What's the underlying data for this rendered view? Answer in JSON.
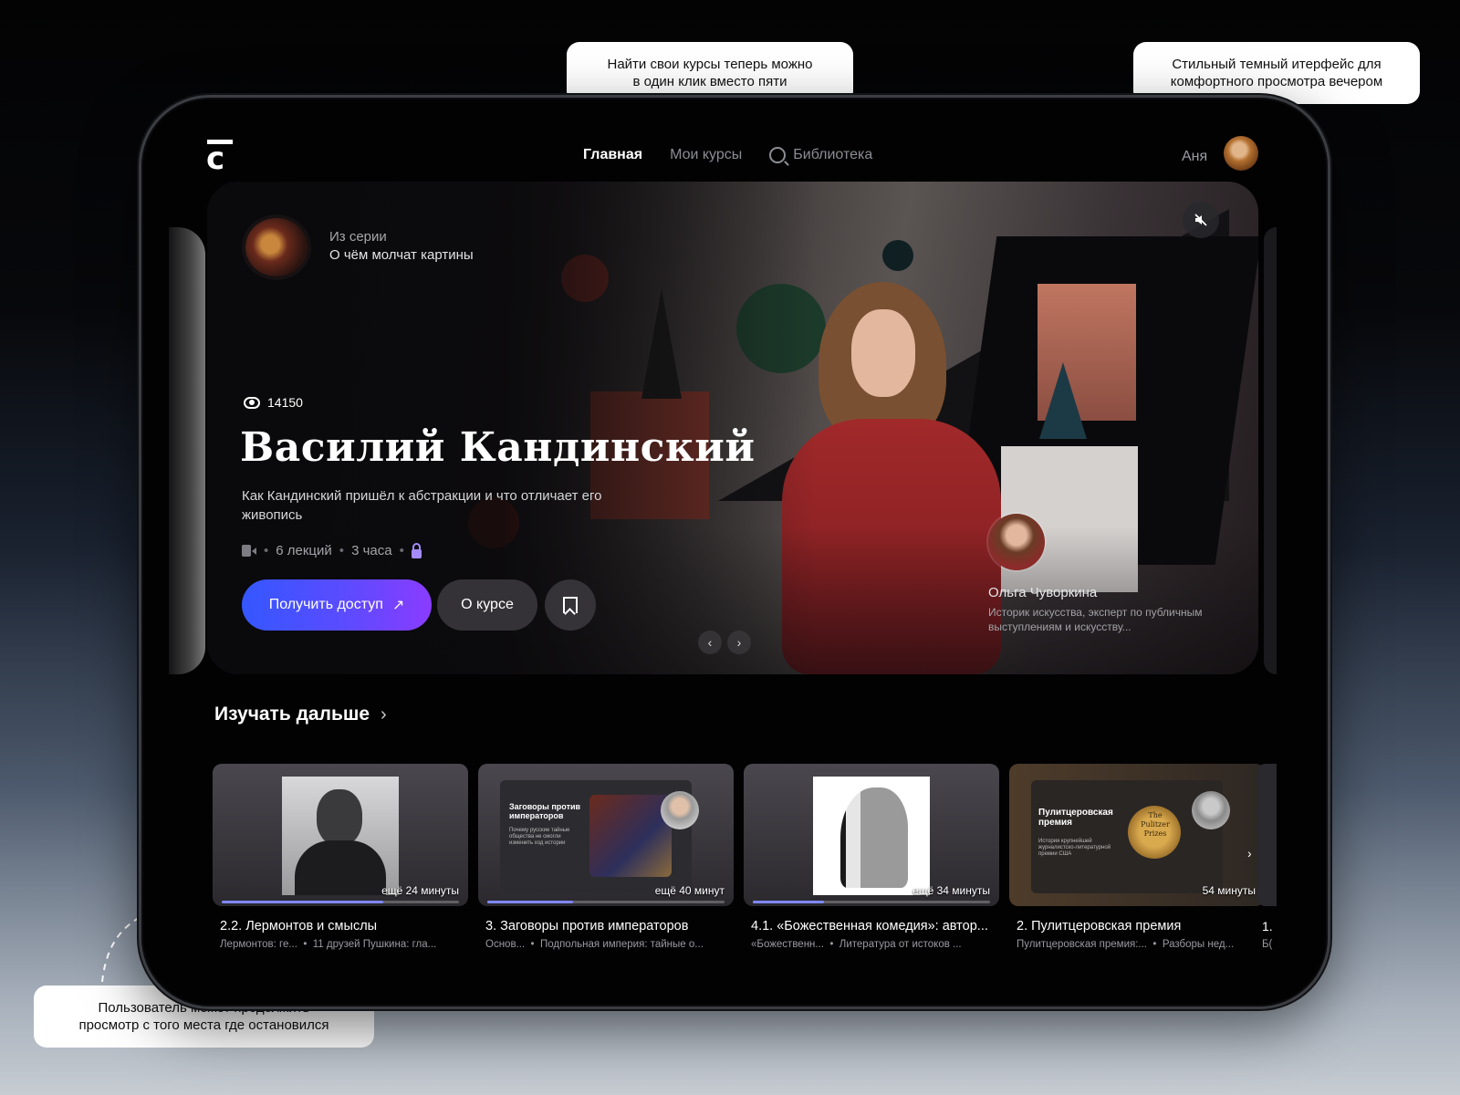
{
  "callouts": {
    "top": [
      "Найти свои курсы теперь можно",
      "в один клик вместо пяти"
    ],
    "right": [
      "Стильный темный итерфейс для",
      "комфортного просмотра вечером"
    ],
    "bottom": [
      "Пользователь может продолжить",
      "просмотр с того места где остановился"
    ]
  },
  "header": {
    "logo": "c",
    "nav": {
      "home": "Главная",
      "my_courses": "Мои курсы",
      "library": "Библиотека"
    },
    "user_name": "Аня"
  },
  "hero": {
    "series_label": "Из серии",
    "series_name": "О чём молчат картины",
    "views": "14150",
    "title": "Василий Кандинский",
    "description": "Как Кандинский пришёл к абстракции и что отличает его живопись",
    "lectures": "6 лекций",
    "duration": "3 часа",
    "cta_label": "Получить доступ",
    "about_label": "О курсе",
    "expert_name": "Ольга Чуворкина",
    "expert_desc": "Историк искусства, эксперт по публичным выступлениям и искусству..."
  },
  "continue": {
    "title": "Изучать дальше",
    "cards": [
      {
        "title": "2.2. Лермонтов и смыслы",
        "course": "Лермонтов: ге...",
        "collection": "11 друзей Пушкина: гла...",
        "time_left": "ещё 24 минуты",
        "progress": 0.68
      },
      {
        "title": "3. Заговоры против императоров",
        "course": "Основ...",
        "collection": "Подпольная империя: тайные о...",
        "time_left": "ещё 40 минут",
        "progress": 0.36,
        "slide_title": "Заговоры против императоров",
        "slide_text": "Почему русские тайные общества не смогли изменить ход истории"
      },
      {
        "title": "4.1. «Божественная комедия»: автор...",
        "course": "«Божественн...",
        "collection": "Литература от истоков ...",
        "time_left": "ещё 34 минуты",
        "progress": 0.3
      },
      {
        "title": "2. Пулитцеровская премия",
        "course": "Пулитцеровская премия:...",
        "collection": "Разборы нед...",
        "time_left": "54 минуты",
        "progress": 0.0,
        "slide_title": "Пулитцеровская премия",
        "slide_text": "История крупнейшей журналистско-литературной премии США",
        "coin_text": "The Pulitzer Prizes"
      }
    ],
    "peek": {
      "title": "1.",
      "sub": "Б("
    }
  }
}
